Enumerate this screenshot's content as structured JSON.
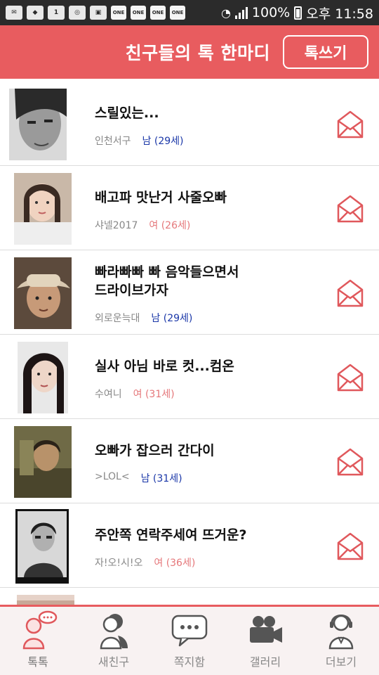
{
  "status_bar": {
    "battery": "100%",
    "time": "오후 11:58",
    "notif_icons": [
      "mail-icon",
      "shield-icon",
      "one-icon",
      "sync-icon",
      "image-icon",
      "one-icon",
      "one-icon",
      "one-icon",
      "one-icon"
    ],
    "one_label": "ONE"
  },
  "header": {
    "title": "친구들의 톡 한마디",
    "write_button": "톡쓰기",
    "color": "#e85c5f"
  },
  "posts": [
    {
      "message": "스릴있는...",
      "nickname": "인천서구",
      "gender_age": "남 (29세)",
      "gender": "m"
    },
    {
      "message": "배고파 맛난거 사줄오빠",
      "nickname": "샤넬2017",
      "gender_age": "여 (26세)",
      "gender": "f"
    },
    {
      "message_line1": "빠라빠빠 빠 음악들으면서",
      "message_line2": "드라이브가자",
      "nickname": "외로운늑대",
      "gender_age": "남 (29세)",
      "gender": "m"
    },
    {
      "message": "실사 아님 바로 컷...컴온",
      "nickname": "수여니",
      "gender_age": "여 (31세)",
      "gender": "f"
    },
    {
      "message": "오빠가 잡으러 간다이",
      "nickname": ">LOL<",
      "gender_age": "남 (31세)",
      "gender": "m"
    },
    {
      "message": "주안쪽 연락주세여 뜨거운?",
      "nickname": "자!오!시!오",
      "gender_age": "여 (36세)",
      "gender": "f"
    }
  ],
  "tabs": [
    {
      "label": "톡톡",
      "icon": "talk-person-icon",
      "active": true
    },
    {
      "label": "새친구",
      "icon": "new-friend-icon",
      "active": false
    },
    {
      "label": "쪽지함",
      "icon": "message-box-icon",
      "active": false
    },
    {
      "label": "갤러리",
      "icon": "video-camera-icon",
      "active": false
    },
    {
      "label": "더보기",
      "icon": "headset-person-icon",
      "active": false
    }
  ],
  "colors": {
    "accent": "#e85c5f",
    "male": "#1a37a8",
    "female": "#e5777a",
    "mail": "#e0585c"
  }
}
